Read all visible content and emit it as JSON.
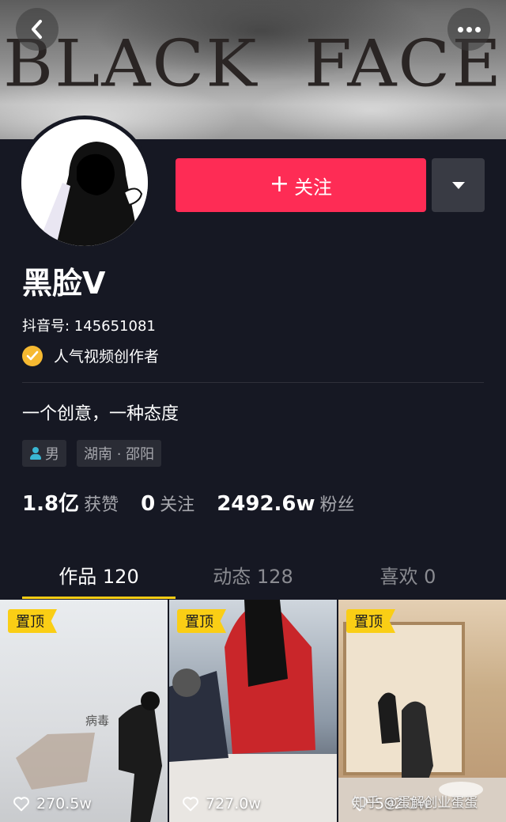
{
  "banner": {
    "title": "BLACK  FACE",
    "back_icon": "chevron-left-icon",
    "more_icon": "more-horizontal-icon"
  },
  "profile": {
    "follow_label": "关注",
    "follow_color": "#fe2c55",
    "name": "黑脸V",
    "douyin_id": "抖音号: 145651081",
    "badge_text": "人气视频创作者",
    "bio": "一个创意，一种态度",
    "gender": "男",
    "location": "湖南 · 邵阳"
  },
  "stats": [
    {
      "value": "1.8亿",
      "label": "获赞"
    },
    {
      "value": "0",
      "label": "关注"
    },
    {
      "value": "2492.6w",
      "label": "粉丝"
    }
  ],
  "tabs": [
    {
      "label": "作品 120"
    },
    {
      "label": "动态 128"
    },
    {
      "label": "喜欢 0"
    }
  ],
  "videos": [
    {
      "pin": "置顶",
      "likes": "270.5w",
      "overlay_text": "病毒"
    },
    {
      "pin": "置顶",
      "likes": "727.0w"
    },
    {
      "pin": "置顶",
      "likes": "592.1w"
    }
  ],
  "watermark": "知乎 @蛋解创业蛋蛋",
  "accent": "#face15"
}
